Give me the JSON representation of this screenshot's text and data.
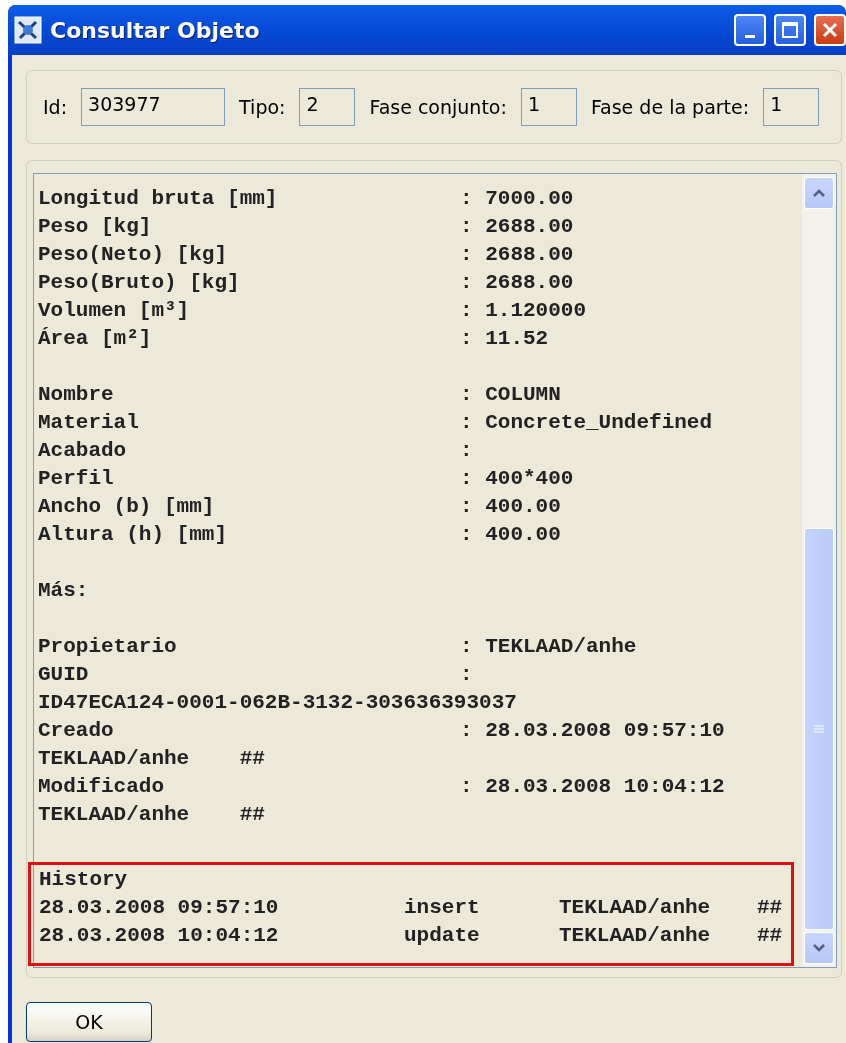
{
  "window": {
    "title": "Consultar Objeto"
  },
  "header_fields": [
    {
      "label": "Id:",
      "value": "303977"
    },
    {
      "label": "Tipo:",
      "value": "2"
    },
    {
      "label": "Fase conjunto:",
      "value": "1"
    },
    {
      "label": "Fase de la parte:",
      "value": "1"
    }
  ],
  "report_lines": [
    {
      "kind": "field",
      "label": "Longitud bruta [mm]",
      "value": ": 7000.00"
    },
    {
      "kind": "field",
      "label": "Peso [kg]",
      "value": ": 2688.00"
    },
    {
      "kind": "field",
      "label": "Peso(Neto) [kg]",
      "value": ": 2688.00"
    },
    {
      "kind": "field",
      "label": "Peso(Bruto) [kg]",
      "value": ": 2688.00"
    },
    {
      "kind": "field",
      "label": "Volumen [m³]",
      "value": ": 1.120000"
    },
    {
      "kind": "field",
      "label": "Área [m²]",
      "value": ": 11.52"
    },
    {
      "kind": "blank"
    },
    {
      "kind": "field",
      "label": "Nombre",
      "value": ": COLUMN"
    },
    {
      "kind": "field",
      "label": "Material",
      "value": ": Concrete_Undefined"
    },
    {
      "kind": "field",
      "label": "Acabado",
      "value": ":"
    },
    {
      "kind": "field",
      "label": "Perfil",
      "value": ": 400*400"
    },
    {
      "kind": "field",
      "label": "Ancho (b) [mm]",
      "value": ": 400.00"
    },
    {
      "kind": "field",
      "label": "Altura (h) [mm]",
      "value": ": 400.00"
    },
    {
      "kind": "blank"
    },
    {
      "kind": "text",
      "text": "Más:"
    },
    {
      "kind": "blank"
    },
    {
      "kind": "field",
      "label": "Propietario",
      "value": ": TEKLAAD/anhe"
    },
    {
      "kind": "field",
      "label": "GUID",
      "value": ":"
    },
    {
      "kind": "text",
      "text": "ID47ECA124-0001-062B-3132-303636393037"
    },
    {
      "kind": "field",
      "label": "Creado",
      "value": ": 28.03.2008 09:57:10"
    },
    {
      "kind": "text",
      "text": "TEKLAAD/anhe    ##"
    },
    {
      "kind": "field",
      "label": "Modificado",
      "value": ": 28.03.2008 10:04:12"
    },
    {
      "kind": "text",
      "text": "TEKLAAD/anhe    ##"
    },
    {
      "kind": "blank"
    }
  ],
  "history": {
    "title": "History",
    "rows": [
      {
        "date": "28.03.2008 09:57:10",
        "action": "insert",
        "user": "TEKLAAD/anhe",
        "mark": "##"
      },
      {
        "date": "28.03.2008 10:04:12",
        "action": "update",
        "user": "TEKLAAD/anhe",
        "mark": "##"
      }
    ]
  },
  "buttons": [
    "OK"
  ]
}
